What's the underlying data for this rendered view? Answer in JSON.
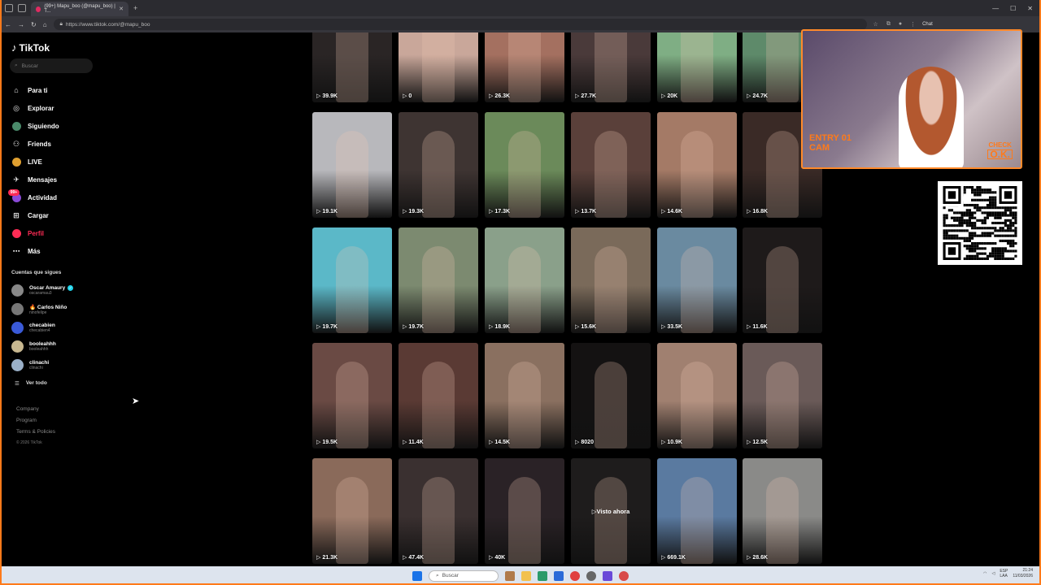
{
  "browser": {
    "tab_title": "(99+) Mapu_boo (@mapu_boo) | T...",
    "url": "https://www.tiktok.com/@mapu_boo",
    "chat_label": "Chat"
  },
  "sidebar": {
    "logo": "TikTok",
    "search_placeholder": "Buscar",
    "nav": [
      {
        "label": "Para ti",
        "icon": "home-icon"
      },
      {
        "label": "Explorar",
        "icon": "compass-icon"
      },
      {
        "label": "Siguiendo",
        "icon": "following-icon"
      },
      {
        "label": "Friends",
        "icon": "friends-icon"
      },
      {
        "label": "LIVE",
        "icon": "live-icon"
      },
      {
        "label": "Mensajes",
        "icon": "messages-icon"
      },
      {
        "label": "Actividad",
        "icon": "activity-icon",
        "badge": "99+"
      },
      {
        "label": "Cargar",
        "icon": "upload-icon"
      },
      {
        "label": "Perfil",
        "icon": "profile-icon",
        "active": true
      },
      {
        "label": "Más",
        "icon": "more-icon"
      }
    ],
    "following_title": "Cuentas que sigues",
    "following": [
      {
        "name": "Oscar Amaury",
        "handle": "oscaramau3",
        "verified": true
      },
      {
        "name": "🔥 Carlos Niño",
        "handle": "ninofelipe",
        "verified": false
      },
      {
        "name": "checabien",
        "handle": "checabien4",
        "verified": false
      },
      {
        "name": "booleahhh",
        "handle": "booleahhh",
        "verified": false
      },
      {
        "name": "clinachi",
        "handle": "clinachi",
        "verified": false
      }
    ],
    "see_all": "Ver todo",
    "footer": [
      "Company",
      "Program",
      "Terms & Policies"
    ],
    "copyright": "© 2026 TikTok"
  },
  "videos": [
    {
      "views": "39.9K",
      "bg": "#2a2525"
    },
    {
      "views": "0",
      "bg": "#c9a79a"
    },
    {
      "views": "26.3K",
      "bg": "#a47060"
    },
    {
      "views": "27.7K",
      "bg": "#4a3a3a"
    },
    {
      "views": "20K",
      "bg": "#7fae84"
    },
    {
      "views": "24.7K",
      "bg": "#5e8a6a"
    },
    {
      "views": "19.1K",
      "bg": "#b8b8bc"
    },
    {
      "views": "19.3K",
      "bg": "#3e3432"
    },
    {
      "views": "17.3K",
      "bg": "#6b8a5a"
    },
    {
      "views": "13.7K",
      "bg": "#5a403a"
    },
    {
      "views": "14.6K",
      "bg": "#a47a66"
    },
    {
      "views": "16.8K",
      "bg": "#3a2a26"
    },
    {
      "views": "19.7K",
      "bg": "#5bb8c8"
    },
    {
      "views": "19.7K",
      "bg": "#7c8a70"
    },
    {
      "views": "18.9K",
      "bg": "#8aa08a"
    },
    {
      "views": "15.6K",
      "bg": "#7a6a5a"
    },
    {
      "views": "33.5K",
      "bg": "#6a8aa0"
    },
    {
      "views": "11.6K",
      "bg": "#1e1a1a"
    },
    {
      "views": "19.5K",
      "bg": "#6a4a44"
    },
    {
      "views": "11.4K",
      "bg": "#5a3a34"
    },
    {
      "views": "14.5K",
      "bg": "#8a7060"
    },
    {
      "views": "8020",
      "bg": "#141212"
    },
    {
      "views": "10.9K",
      "bg": "#a08070"
    },
    {
      "views": "12.5K",
      "bg": "#6a5a58"
    },
    {
      "views": "21.3K",
      "bg": "#8a6a5a"
    },
    {
      "views": "47.4K",
      "bg": "#3a3030"
    },
    {
      "views": "40K",
      "bg": "#2a2226"
    },
    {
      "views": "",
      "bg": "#1e1c1c",
      "overlay": "Visto ahora"
    },
    {
      "views": "669.1K",
      "bg": "#5a7aa0"
    },
    {
      "views": "28.6K",
      "bg": "#8a8a88"
    }
  ],
  "cam": {
    "entry_line1": "ENTRY 01",
    "entry_line2": "CAM",
    "check": "CHECK",
    "ok": "O.K."
  },
  "taskbar": {
    "search_placeholder": "Buscar",
    "lang": "ESP",
    "lang2": "LAA",
    "time": "21:24",
    "date": "11/03/2026"
  }
}
